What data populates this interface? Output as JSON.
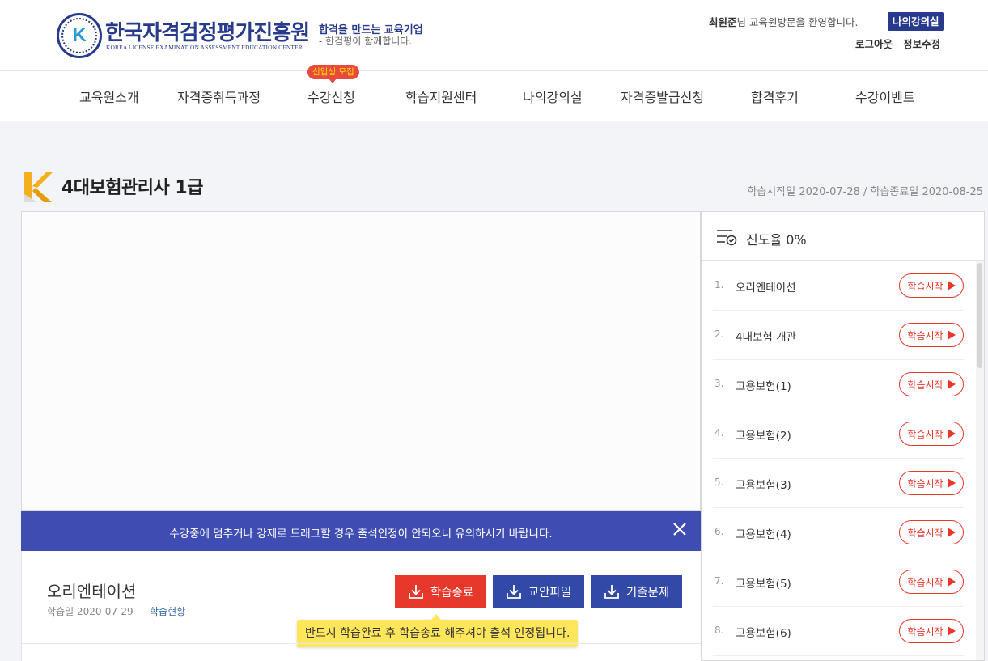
{
  "header": {
    "logo_title": "한국자격검정평가진흥원",
    "logo_subtitle": "KOREA LICENSE EXAMINATION ASSESSMENT  EDUCATION CENTER",
    "logo_letter": "K",
    "slogan_main": "합격을 만드는 교육기업",
    "slogan_sub": "- 한검평이 함께합니다.",
    "user_name": "최원준",
    "welcome_text": "님 교육원방문을 환영합니다.",
    "my_classroom_button": "나의강의실",
    "logout_link": "로그아웃",
    "edit_info_link": "정보수정"
  },
  "nav": {
    "items": [
      "교육원소개",
      "자격증취득과정",
      "수강신청",
      "학습지원센터",
      "나의강의실",
      "자격증발급신청",
      "합격후기",
      "수강이벤트"
    ],
    "badge": "신입생 모집"
  },
  "course": {
    "title": "4대보험관리사 1급",
    "dates": "학습시작일  2020-07-28 / 학습종료일  2020-08-25"
  },
  "player": {
    "notice": "수강중에 멈추거나 강제로 드래그할 경우 출석인정이 안되오니 유의하시기 바랍니다."
  },
  "lesson_info": {
    "title": "오리엔테이션",
    "date_label": "학습일  2020-07-29",
    "status_link": "학습현황",
    "buttons": {
      "end": "학습종료",
      "file": "교안파일",
      "exam": "기출문제"
    },
    "tooltip": "반드시 학습완료 후 학습송료 해주셔야 출석 인정됩니다."
  },
  "sidebar": {
    "progress_label": "진도율 0%",
    "progress_value": 0,
    "start_button": "학습시작",
    "lessons": [
      {
        "num": "1.",
        "name": "오리엔테이션"
      },
      {
        "num": "2.",
        "name": "4대보험 개관"
      },
      {
        "num": "3.",
        "name": "고용보험(1)"
      },
      {
        "num": "4.",
        "name": "고용보험(2)"
      },
      {
        "num": "5.",
        "name": "고용보험(3)"
      },
      {
        "num": "6.",
        "name": "고용보험(4)"
      },
      {
        "num": "7.",
        "name": "고용보험(5)"
      },
      {
        "num": "8.",
        "name": "고용보험(6)"
      }
    ]
  },
  "colors": {
    "brand_navy": "#273a8c",
    "notice_blue": "#3f4db3",
    "button_blue": "#3349a8",
    "accent_red": "#e8382c",
    "tooltip_yellow": "#ffe65a"
  }
}
